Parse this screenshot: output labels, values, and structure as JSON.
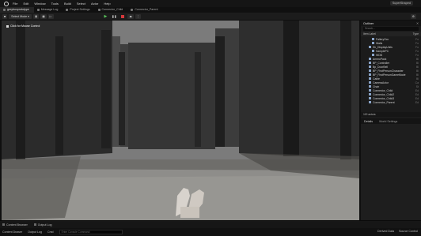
{
  "menubar": {
    "items": [
      "File",
      "Edit",
      "Window",
      "Tools",
      "Build",
      "Select",
      "Actor",
      "Help"
    ],
    "build_tag": "SuperShaped"
  },
  "tabs": [
    {
      "label": "greyboxprototype",
      "active": true
    },
    {
      "label": "Message Log",
      "active": false
    },
    {
      "label": "Project Settings",
      "active": false
    },
    {
      "label": "Connector_Child",
      "active": false
    },
    {
      "label": "Connector_Parent",
      "active": false
    }
  ],
  "toolbar": {
    "mode_label": "Select Mode",
    "play_icon": "play-icon",
    "pause_icon": "pause-icon",
    "stop_icon": "stop-icon",
    "platforms_label": "Platforms"
  },
  "viewport": {
    "hint": "Click for Mouse Control"
  },
  "outliner": {
    "title": "Outliner",
    "search_placeholder": "Search...",
    "col_label": "Item Label",
    "col_type": "Type",
    "rows": [
      {
        "label": "FalleryOcc",
        "type": "Fo"
      },
      {
        "label": "Walls",
        "type": "Fo"
      },
      {
        "label": "Sh_DisplayUnits",
        "type": "Fo"
      },
      {
        "label": "SamplePC",
        "type": "Fo"
      },
      {
        "label": "WDB",
        "type": "Fo"
      },
      {
        "label": "AmmoPack",
        "type": "Bl"
      },
      {
        "label": "BP_Controller",
        "type": "Bl"
      },
      {
        "label": "Bp_DoorBell",
        "type": "Bl"
      },
      {
        "label": "BP_FirstPersonCharacter",
        "type": "Bl"
      },
      {
        "label": "BP_FirstPersonGameMode",
        "type": "Bl"
      },
      {
        "label": "Cable",
        "type": "Bl"
      },
      {
        "label": "CameraActor",
        "type": "Ca"
      },
      {
        "label": "Chair",
        "type": "St"
      },
      {
        "label": "Connector_Child",
        "type": "Ed"
      },
      {
        "label": "Connector_Child2",
        "type": "Ed"
      },
      {
        "label": "Connector_Child3",
        "type": "Ed"
      },
      {
        "label": "Connector_Parent",
        "type": "Ed"
      }
    ],
    "actor_count": "119 actors"
  },
  "details": {
    "tab_details": "Details",
    "tab_world": "World Settings"
  },
  "bottom_tabs": [
    "Content Browser",
    "Output Log"
  ],
  "statusbar": {
    "drawer": "Content Drawer",
    "output_log": "Output Log",
    "cmd_label": "Cmd",
    "cmd_placeholder": "Enter Console Command",
    "derived": "Derived Data",
    "source": "Source Control"
  },
  "colors": {
    "play": "#59c25a",
    "stop": "#d6383b"
  }
}
